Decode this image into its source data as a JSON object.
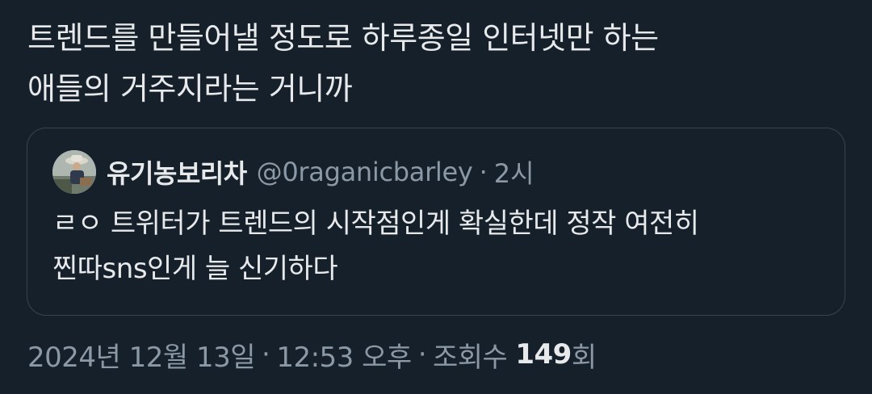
{
  "tweet": {
    "text": "트렌드를 만들어낼 정도로 하루종일 인터넷만 하는\n애들의 거주지라는 거니까"
  },
  "quote": {
    "display_name": "유기농보리차",
    "handle": "@0raganicbarley",
    "separator": "·",
    "time": "2시",
    "text": "ㄹㅇ 트위터가 트렌드의 시작점인게 확실한데 정작 여전히\n찐따sns인게 늘 신기하다"
  },
  "meta": {
    "date": "2024년 12월 13일",
    "separator": "·",
    "time": "12:53 오후",
    "views_label": "조회수",
    "views_count": "149",
    "views_unit": "회"
  },
  "colors": {
    "background": "#15202b",
    "text_primary": "#e7e9ea",
    "text_secondary": "#8b98a5",
    "border": "#38444d"
  }
}
